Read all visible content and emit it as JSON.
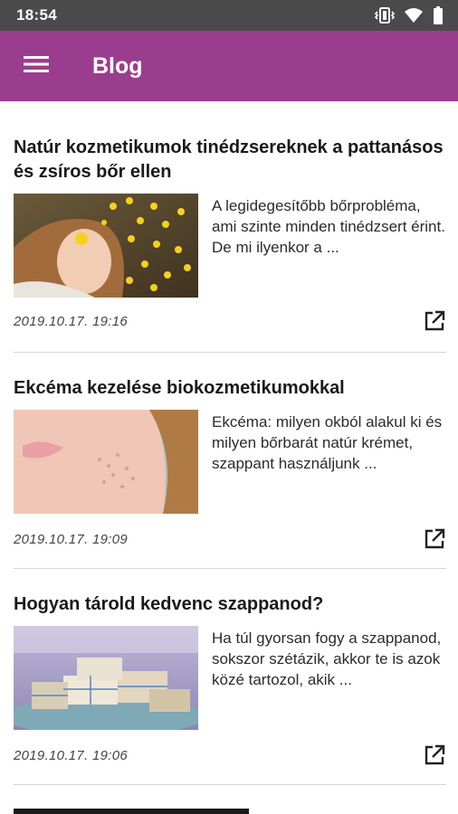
{
  "status_bar": {
    "time": "18:54",
    "icons": [
      "vibrate-icon",
      "wifi-icon",
      "battery-icon"
    ]
  },
  "app_bar": {
    "title": "Blog",
    "menu_icon": "hamburger-menu-icon",
    "background_color": "#9b3d8f"
  },
  "posts": [
    {
      "title": "Natúr kozmetikumok tinédzsereknek a pattanásos és zsíros bőr ellen",
      "excerpt": "A legidegesítőbb bőrprobléma, ami szinte minden tinédzsert érint. De mi ilyenkor a ...",
      "date": "2019.10.17. 19:16",
      "share_icon": "open-external-icon"
    },
    {
      "title": "Ekcéma kezelése biokozmetikumokkal",
      "excerpt": "Ekcéma: milyen okból alakul ki és milyen bőrbarát natúr krémet, szappant használjunk ...",
      "date": "2019.10.17. 19:09",
      "share_icon": "open-external-icon"
    },
    {
      "title": "Hogyan tárold kedvenc szappanod?",
      "excerpt": "Ha túl gyorsan fogy a szappanod, sokszor szétázik, akkor te is azok közé tartozol, akik ...",
      "date": "2019.10.17. 19:06",
      "share_icon": "open-external-icon"
    }
  ]
}
